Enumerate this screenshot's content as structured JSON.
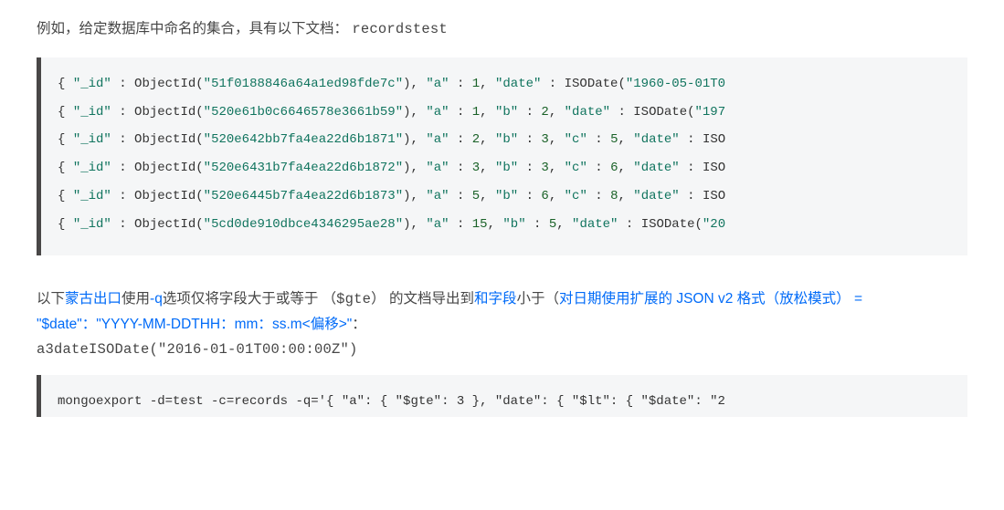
{
  "para1": {
    "prefix": "例如，给定数据库中命名的集合，具有以下文档：",
    "code": "recordstest"
  },
  "code1": {
    "rows": [
      {
        "id_hex": "51f0188846a64a1ed98fde7c",
        "tail_raw": ", \"a\" : 1, \"date\" : ISODate(\"1960-05-01T0",
        "a": 1,
        "date_partial": "1960-05-01T0"
      },
      {
        "id_hex": "520e61b0c6646578e3661b59",
        "tail_raw": ", \"a\" : 1, \"b\" : 2, \"date\" : ISODate(\"197",
        "a": 1,
        "b": 2,
        "date_partial": "197"
      },
      {
        "id_hex": "520e642bb7fa4ea22d6b1871",
        "tail_raw": ", \"a\" : 2, \"b\" : 3, \"c\" : 5, \"date\" : ISO",
        "a": 2,
        "b": 3,
        "c": 5
      },
      {
        "id_hex": "520e6431b7fa4ea22d6b1872",
        "tail_raw": ", \"a\" : 3, \"b\" : 3, \"c\" : 6, \"date\" : ISO",
        "a": 3,
        "b": 3,
        "c": 6
      },
      {
        "id_hex": "520e6445b7fa4ea22d6b1873",
        "tail_raw": ", \"a\" : 5, \"b\" : 6, \"c\" : 8, \"date\" : ISO",
        "a": 5,
        "b": 6,
        "c": 8
      },
      {
        "id_hex": "5cd0de910dbce4346295ae28",
        "tail_raw": ", \"a\" : 15, \"b\" : 5, \"date\" : ISODate(\"20",
        "a": 15,
        "b": 5,
        "date_partial": "20"
      }
    ]
  },
  "para2": {
    "t1": "以下",
    "link1": "蒙古出口",
    "t2": "使用",
    "link2": "-q",
    "t3": "选项仅将字段大于或等于 （",
    "code1": "$gte",
    "t4": "） 的文档导出到",
    "link3": "和字段",
    "t5": "小于（",
    "link4_part_a": "对日期使用扩展的 JSON v2 格式（放松模式）",
    "link4_eq": " = ",
    "link4_part_b": "\"$date\"：\"YYYY-MM-DDTHH：mm：ss.m<偏移>\"",
    "t6": "：",
    "line3_code": "a3dateISODate(\"2016-01-01T00:00:00Z\")"
  },
  "code2": {
    "line": "mongoexport -d=test -c=records -q='{ \"a\": { \"$gte\": 3 }, \"date\": { \"$lt\": { \"$date\": \"2"
  }
}
